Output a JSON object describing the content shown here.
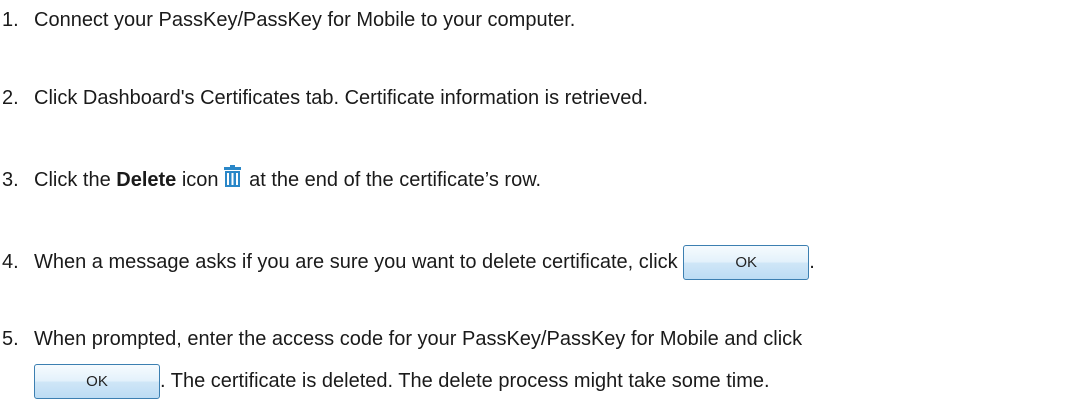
{
  "steps": [
    {
      "number": "1.",
      "text": "Connect your PassKey/PassKey for Mobile to your computer."
    },
    {
      "number": "2.",
      "text": "Click Dashboard's Certificates tab. Certificate information is retrieved."
    },
    {
      "number": "3.",
      "before": "Click the ",
      "bold": "Delete",
      "middle": " icon",
      "after": " at the end of the certificate’s row."
    },
    {
      "number": "4.",
      "text": "When a message asks if you are sure you want to delete certificate, click ",
      "end": "."
    },
    {
      "number": "5.",
      "text": "When prompted, enter the access code for your PassKey/PassKey for Mobile and click",
      "after": ". The certificate is deleted. The delete process might take some time."
    }
  ],
  "ok_button_label": "OK",
  "icons": {
    "delete": "trash-icon"
  },
  "colors": {
    "trash": "#2a87c8",
    "button_border": "#3c7fb1"
  }
}
